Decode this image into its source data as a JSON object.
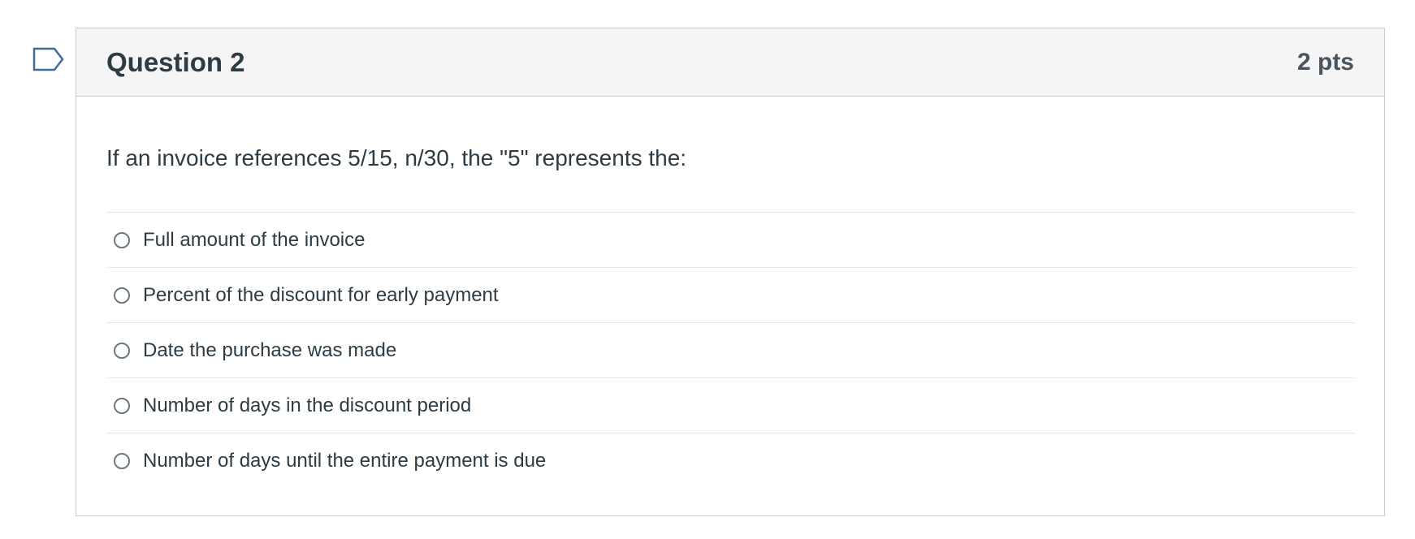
{
  "question": {
    "title": "Question 2",
    "points": "2 pts",
    "text": "If an invoice references 5/15, n/30, the \"5\" represents the:",
    "answers": [
      {
        "label": "Full amount of the invoice"
      },
      {
        "label": "Percent of the discount for early payment"
      },
      {
        "label": "Date the purchase was made"
      },
      {
        "label": "Number of days in the discount period"
      },
      {
        "label": "Number of days until the entire payment is due"
      }
    ]
  },
  "colors": {
    "header_bg": "#f5f5f5",
    "border": "#c7cdd1",
    "text": "#2d3b45",
    "flag_outline": "#3b6c9b"
  },
  "icons": {
    "flag": "flag-question-icon",
    "radio": "radio-unchecked-icon"
  }
}
